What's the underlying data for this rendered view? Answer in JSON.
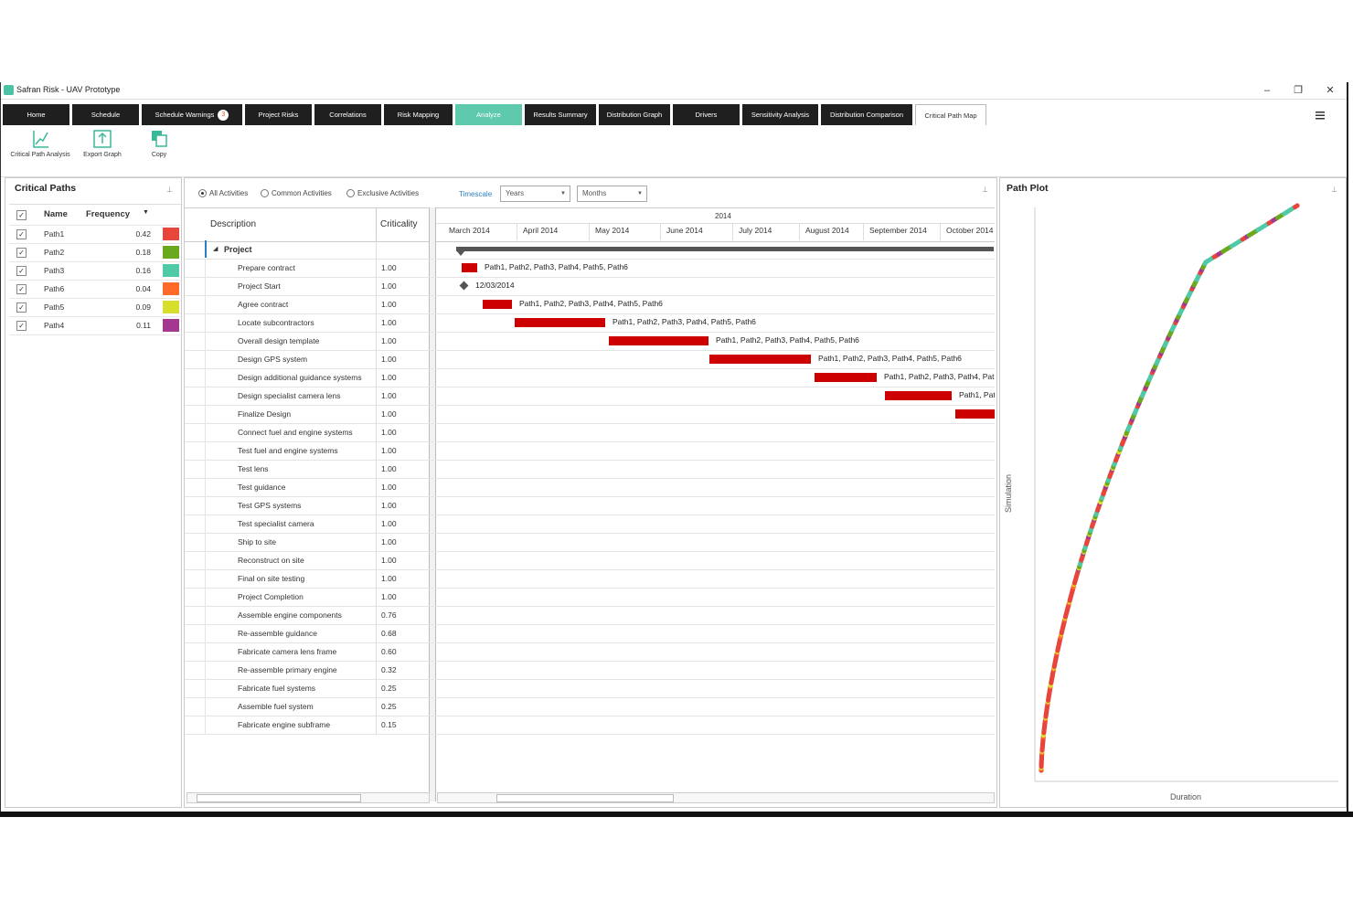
{
  "window": {
    "title": "Safran Risk - UAV Prototype",
    "minimize": "–",
    "restore": "❐",
    "close": "✕"
  },
  "tabs": [
    {
      "label": "Home"
    },
    {
      "label": "Schedule"
    },
    {
      "label": "Schedule Warnings",
      "badge": "3"
    },
    {
      "label": "Project Risks"
    },
    {
      "label": "Correlations"
    },
    {
      "label": "Risk Mapping"
    },
    {
      "label": "Analyze",
      "active": true
    },
    {
      "label": "Results Summary"
    },
    {
      "label": "Distribution Graph"
    },
    {
      "label": "Drivers"
    },
    {
      "label": "Sensitivity Analysis"
    },
    {
      "label": "Distribution Comparison"
    },
    {
      "label": "Critical Path Map",
      "selected": true
    }
  ],
  "ribbon": {
    "critical_path_analysis": "Critical Path Analysis",
    "export_graph": "Export Graph",
    "copy": "Copy"
  },
  "critical_paths": {
    "title": "Critical Paths",
    "col_name": "Name",
    "col_frequency": "Frequency",
    "rows": [
      {
        "name": "Path1",
        "frequency": "0.42",
        "color": "#e8453c"
      },
      {
        "name": "Path2",
        "frequency": "0.18",
        "color": "#6aa81e"
      },
      {
        "name": "Path3",
        "frequency": "0.16",
        "color": "#4fc9a8"
      },
      {
        "name": "Path6",
        "frequency": "0.04",
        "color": "#ff6a2a"
      },
      {
        "name": "Path5",
        "frequency": "0.09",
        "color": "#d9de2c"
      },
      {
        "name": "Path4",
        "frequency": "0.11",
        "color": "#a4378f"
      }
    ]
  },
  "filter": {
    "all": "All Activities",
    "common": "Common Activities",
    "exclusive": "Exclusive Activities",
    "timescale_label": "Timescale",
    "timescale_major": "Years",
    "timescale_minor": "Months"
  },
  "gantt": {
    "col_description": "Description",
    "col_criticality": "Criticality",
    "year": "2014",
    "months": [
      "March 2014",
      "April 2014",
      "May 2014",
      "June 2014",
      "July 2014",
      "August 2014",
      "September 2014",
      "October 2014"
    ],
    "project_label": "Project",
    "milestone_label": "12/03/2014",
    "activities": [
      {
        "desc": "Prepare contract",
        "crit": "1.00",
        "bar_label": "Path1, Path2, Path3, Path4, Path5, Path6"
      },
      {
        "desc": "Project Start",
        "crit": "1.00"
      },
      {
        "desc": "Agree contract",
        "crit": "1.00",
        "bar_label": "Path1, Path2, Path3, Path4, Path5, Path6"
      },
      {
        "desc": "Locate subcontractors",
        "crit": "1.00",
        "bar_label": "Path1, Path2, Path3, Path4, Path5, Path6"
      },
      {
        "desc": "Overall design template",
        "crit": "1.00",
        "bar_label": "Path1, Path2, Path3, Path4, Path5, Path6"
      },
      {
        "desc": "Design GPS system",
        "crit": "1.00",
        "bar_label": "Path1, Path2, Path3, Path4, Path5, Path6"
      },
      {
        "desc": "Design additional guidance systems",
        "crit": "1.00",
        "bar_label": "Path1, Path2, Path3, Path4, Pat"
      },
      {
        "desc": "Design specialist camera lens",
        "crit": "1.00",
        "bar_label": "Path1, Pat"
      },
      {
        "desc": "Finalize Design",
        "crit": "1.00"
      },
      {
        "desc": "Connect fuel and engine systems",
        "crit": "1.00"
      },
      {
        "desc": "Test fuel and engine systems",
        "crit": "1.00"
      },
      {
        "desc": "Test lens",
        "crit": "1.00"
      },
      {
        "desc": "Test guidance",
        "crit": "1.00"
      },
      {
        "desc": "Test GPS systems",
        "crit": "1.00"
      },
      {
        "desc": "Test specialist camera",
        "crit": "1.00"
      },
      {
        "desc": "Ship to site",
        "crit": "1.00"
      },
      {
        "desc": "Reconstruct on site",
        "crit": "1.00"
      },
      {
        "desc": "Final on site testing",
        "crit": "1.00"
      },
      {
        "desc": "Project Completion",
        "crit": "1.00"
      },
      {
        "desc": "Assemble engine components",
        "crit": "0.76"
      },
      {
        "desc": "Re-assemble guidance",
        "crit": "0.68"
      },
      {
        "desc": "Fabricate camera lens frame",
        "crit": "0.60"
      },
      {
        "desc": "Re-assemble primary engine",
        "crit": "0.32"
      },
      {
        "desc": "Fabricate fuel systems",
        "crit": "0.25"
      },
      {
        "desc": "Assemble fuel system",
        "crit": "0.25"
      },
      {
        "desc": "Fabricate engine subframe",
        "crit": "0.15"
      }
    ]
  },
  "path_plot": {
    "title": "Path Plot",
    "xlabel": "Duration",
    "ylabel": "Simulation"
  }
}
